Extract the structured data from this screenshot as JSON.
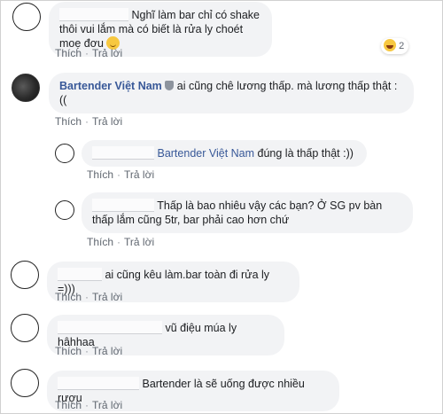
{
  "actions": {
    "like": "Thích",
    "reply": "Trả lời",
    "separator": "·"
  },
  "comments": [
    {
      "text": "Nghĩ làm bar chỉ có shake thôi vui lắm mà có biết là rửa ly choét moẹ đơu",
      "reaction_count": "2",
      "reaction_icon": "haha-emoji-icon"
    },
    {
      "author": "Bartender Việt Nam",
      "text": "ai cũng chê lương thấp. mà lương thấp thật :(("
    },
    {
      "mention": "Bartender Việt Nam",
      "text": "đúng là thấp thật :))"
    },
    {
      "text": "Thấp là bao nhiêu vậy các bạn? Ở SG pv bàn thấp lắm cũng 5tr, bar phải cao hơn chứ"
    },
    {
      "text": "ai cũng kêu làm.bar toàn đi rửa ly =)))"
    },
    {
      "text": "vũ điệu múa ly hâhhaa"
    },
    {
      "text": "Bartender là sẽ uống được nhiều rượu"
    }
  ],
  "colors": {
    "name_link": "#385898",
    "bubble_bg": "#f2f3f5",
    "action_text": "#606770"
  }
}
